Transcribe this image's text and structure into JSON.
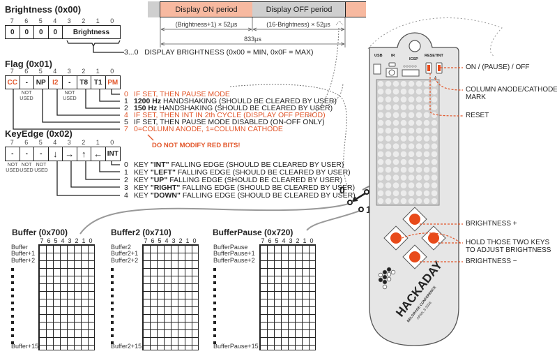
{
  "brightness_reg": {
    "title": "Brightness (0x00)",
    "bit_numbers": [
      "7",
      "6",
      "5",
      "4",
      "3",
      "2",
      "1",
      "0"
    ],
    "cells": [
      "0",
      "0",
      "0",
      "0"
    ],
    "field_label": "Brightness",
    "desc_num": "3...0",
    "desc": "DISPLAY BRIGHTNESS (0x00 = MIN, 0x0F = MAX)"
  },
  "timing": {
    "on_label": "Display ON period",
    "off_label": "Display OFF period",
    "on_duration": "(Brightness+1) × 52µs",
    "off_duration": "(16-Brightness) × 52µs",
    "total": "833µs",
    "on_color": "#f7b9a0",
    "off_color": "#cfcfcf"
  },
  "flag_reg": {
    "title": "Flag (0x01)",
    "bit_numbers": [
      "7",
      "6",
      "5",
      "4",
      "3",
      "2",
      "1",
      "0"
    ],
    "cells": [
      {
        "label": "CC",
        "red": true
      },
      {
        "label": "-",
        "red": false
      },
      {
        "label": "NP",
        "red": false
      },
      {
        "label": "I2",
        "red": true
      },
      {
        "label": "-",
        "red": false
      },
      {
        "label": "T8",
        "red": false
      },
      {
        "label": "T1",
        "red": false
      },
      {
        "label": "PM",
        "red": true
      }
    ],
    "not_used": "NOT USED",
    "descs": [
      {
        "num": "0",
        "pre": "",
        "bold": "",
        "text": "IF SET, THEN PAUSE MODE",
        "red": true
      },
      {
        "num": "1",
        "pre": "",
        "bold": "1200 Hz",
        "text": " HANDSHAKING (SHOULD BE CLEARED BY USER)",
        "red": false
      },
      {
        "num": "2",
        "pre": "",
        "bold": "150 Hz",
        "text": " HANDSHAKING (SHOULD BE CLEARED BY USER)",
        "red": false
      },
      {
        "num": "4",
        "pre": "",
        "bold": "",
        "text": "IF SET, THEN INT IN 2th CYCLE (DISPLAY OFF PERIOD)",
        "red": true
      },
      {
        "num": "5",
        "pre": "",
        "bold": "",
        "text": "IF SET, THEN PAUSE MODE DISABLED (ON-OFF ONLY)",
        "red": false
      },
      {
        "num": "7",
        "pre": "",
        "bold": "",
        "text": "0=COLUMN ANODE, 1=COLUMN CATHODE",
        "red": true
      }
    ],
    "warning": "DO NOT MODIFY RED BITS!"
  },
  "keyedge_reg": {
    "title": "KeyEdge (0x02)",
    "bit_numbers": [
      "7",
      "6",
      "5",
      "4",
      "3",
      "2",
      "1",
      "0"
    ],
    "cells": [
      "-",
      "-",
      "-",
      "↓",
      "→",
      "↑",
      "←",
      "INT"
    ],
    "not_used": "NOT USED",
    "descs": [
      {
        "num": "0",
        "pre": "KEY ",
        "bold": "\"INT\"",
        "text": " FALLING EDGE (SHOULD BE CLEARED BY USER)"
      },
      {
        "num": "1",
        "pre": "KEY ",
        "bold": "\"LEFT\"",
        "text": " FALLING EDGE (SHOULD BE CLEARED BY USER)"
      },
      {
        "num": "2",
        "pre": "KEY ",
        "bold": "\"UP\"",
        "text": " FALLING EDGE (SHOULD BE CLEARED BY USER)"
      },
      {
        "num": "3",
        "pre": "KEY ",
        "bold": "\"RIGHT\"",
        "text": " FALLING EDGE (SHOULD BE CLEARED BY USER)"
      },
      {
        "num": "4",
        "pre": "KEY ",
        "bold": "\"DOWN\"",
        "text": " FALLING EDGE (SHOULD BE CLEARED BY USER)"
      }
    ]
  },
  "switch": {
    "pos0": "0",
    "pos1": "1"
  },
  "buffers": [
    {
      "title": "Buffer (0x700)",
      "rows": [
        "Buffer",
        "Buffer+1",
        "Buffer+2"
      ],
      "last": "Buffer+15"
    },
    {
      "title": "Buffer2 (0x710)",
      "rows": [
        "Buffer2",
        "Buffer2+1",
        "Buffer2+2"
      ],
      "last": "Buffer2+15"
    },
    {
      "title": "BufferPause (0x720)",
      "rows": [
        "BufferPause",
        "BufferPause+1",
        "BufferPause+2"
      ],
      "last": "BufferPause+15"
    }
  ],
  "buffer_cols": [
    "7",
    "6",
    "5",
    "4",
    "3",
    "2",
    "1",
    "0"
  ],
  "badge": {
    "usb": "USB",
    "ir": "IR",
    "icsp": "ICSP",
    "reset": "RESET",
    "int": "INT",
    "brand": "HACKADAY",
    "sub": "BELGRADE CONFERENCE",
    "date": "APRIL 9 2016"
  },
  "callouts": {
    "on_off": "ON / (PAUSE) / OFF",
    "col_mark": "COLUMN ANODE/CATHODE\nMARK",
    "col_mark_1": "COLUMN ANODE/CATHODE",
    "col_mark_2": "MARK",
    "reset": "RESET",
    "bright_plus": "BRIGHTNESS +",
    "hold_1": "HOLD THOSE TWO KEYS",
    "hold_2": "TO ADJUST BRIGHTNESS",
    "bright_minus": "BRIGHTNESS −"
  },
  "colors": {
    "accent": "#e2562a",
    "key": "#e84a1a",
    "badge": "#e6e6e6"
  }
}
